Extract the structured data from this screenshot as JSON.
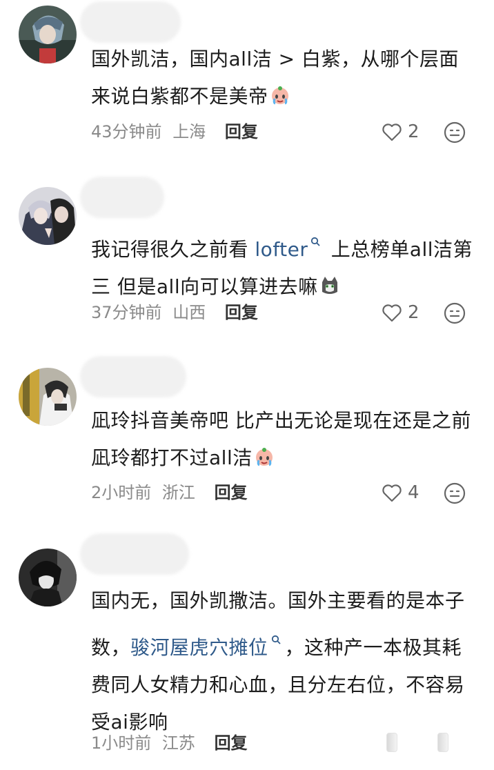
{
  "comments": [
    {
      "text_parts": [
        "国外凯洁，国内all洁 > 白紫，从哪个层面来说白紫都不是美帝"
      ],
      "time": "43分钟前",
      "location": "上海",
      "reply_label": "回复",
      "likes": "2"
    },
    {
      "text_before": "我记得很久之前看 ",
      "link": "lofter",
      "text_after": " 上总榜单all洁第三 但是all向可以算进去嘛",
      "time": "37分钟前",
      "location": "山西",
      "reply_label": "回复",
      "likes": "2"
    },
    {
      "text": "凪玲抖音美帝吧 比产出无论是现在还是之前 凪玲都打不过all洁",
      "time": "2小时前",
      "location": "浙江",
      "reply_label": "回复",
      "likes": "4"
    },
    {
      "text_before": "国内无，国外凯撒洁。国外主要看的是本子数，",
      "link": "骏河屋虎穴摊位",
      "text_after": "，这种产一本极其耗费同人女精力和心血，且分左右位，不容易受ai影响",
      "time": "1小时前",
      "location": "江苏",
      "reply_label": "回复"
    }
  ],
  "icons": {
    "like": "heart-outline-icon",
    "react": "emoji-face-icon",
    "link": "search-icon",
    "crying": "crying-emoji-icon",
    "cat": "cat-emoji-icon"
  }
}
